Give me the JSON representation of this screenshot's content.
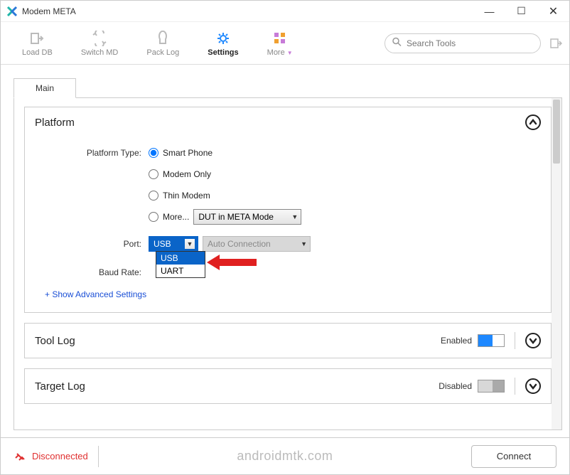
{
  "titlebar": {
    "title": "Modem META"
  },
  "toolbar": {
    "items": [
      {
        "label": "Load DB"
      },
      {
        "label": "Switch MD"
      },
      {
        "label": "Pack Log"
      },
      {
        "label": "Settings"
      },
      {
        "label": "More"
      }
    ],
    "search_placeholder": "Search Tools"
  },
  "tabs": {
    "main": "Main"
  },
  "platform": {
    "title": "Platform",
    "type_label": "Platform Type:",
    "options": {
      "smart_phone": "Smart Phone",
      "modem_only": "Modem Only",
      "thin_modem": "Thin Modem",
      "more": "More..."
    },
    "more_combo": "DUT in META Mode",
    "port_label": "Port:",
    "port_value": "USB",
    "port_options": [
      "USB",
      "UART"
    ],
    "auto_conn": "Auto Connection",
    "baud_label": "Baud Rate:",
    "adv_link": "+ Show Advanced Settings"
  },
  "tool_log": {
    "title": "Tool Log",
    "status": "Enabled"
  },
  "target_log": {
    "title": "Target Log",
    "status": "Disabled"
  },
  "bottom": {
    "status": "Disconnected",
    "connect": "Connect",
    "watermark": "androidmtk.com"
  }
}
